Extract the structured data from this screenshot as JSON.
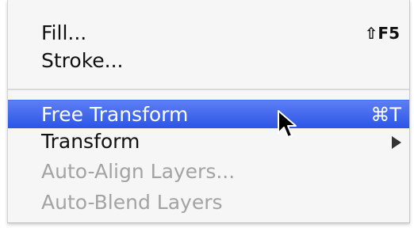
{
  "menu": {
    "items": [
      {
        "label": "Fill...",
        "shortcut": "⇧F5",
        "enabled": true
      },
      {
        "label": "Stroke...",
        "shortcut": "",
        "enabled": true
      },
      {
        "label": "Free Transform",
        "shortcut": "⌘T",
        "enabled": true,
        "highlighted": true
      },
      {
        "label": "Transform",
        "shortcut": "",
        "enabled": true,
        "submenu": true
      },
      {
        "label": "Auto-Align Layers...",
        "shortcut": "",
        "enabled": false
      },
      {
        "label": "Auto-Blend Layers",
        "shortcut": "",
        "enabled": false
      }
    ]
  },
  "icons": {
    "submenu_arrow": "chevron-right-icon",
    "cursor": "arrow-cursor-icon"
  },
  "colors": {
    "highlight_top": "#5d7ef4",
    "highlight_bottom": "#2b55e6",
    "disabled_text": "#a3a3a3",
    "menu_background": "#f6f6f6"
  }
}
